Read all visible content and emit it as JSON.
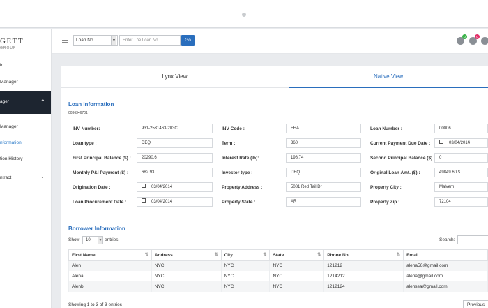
{
  "sidebar": {
    "logo": "GETT",
    "logo_sub": "GROUP",
    "items": [
      {
        "label": "in"
      },
      {
        "label": "Manager"
      },
      {
        "label": "ager"
      },
      {
        "label": "Manager"
      },
      {
        "label": "nformation"
      },
      {
        "label": "tion History"
      },
      {
        "label": "ntract"
      }
    ]
  },
  "header": {
    "select_value": "Loan No.",
    "input_placeholder": "Enter The Loan No.",
    "go_label": "Go",
    "badges": [
      "0",
      "0"
    ]
  },
  "tabs": [
    {
      "label": "Lynx View"
    },
    {
      "label": "Native View"
    }
  ],
  "loan_info": {
    "title": "Loan Information",
    "loan_id": "0036346701",
    "fields": [
      {
        "label": "INV Number:",
        "value": "931-2531463-203C"
      },
      {
        "label": "INV Code :",
        "value": "FHA"
      },
      {
        "label": "Loan Number :",
        "value": "00006"
      },
      {
        "label": "Loan type :",
        "value": "DEQ"
      },
      {
        "label": "Term :",
        "value": "360"
      },
      {
        "label": "Current Payment Due Date :",
        "value": "03/04/2014"
      },
      {
        "label": "First Principal Balance ($) :",
        "value": "20290.6"
      },
      {
        "label": "Interest Rate (%):",
        "value": "198.74"
      },
      {
        "label": "Second Principal Balance ($) :",
        "value": "0"
      },
      {
        "label": "Monthly P&I Payment ($) :",
        "value": "682.93"
      },
      {
        "label": "Investor type :",
        "value": "DEQ"
      },
      {
        "label": "Original Loan Amt. ($) :",
        "value": "49849.60 $"
      },
      {
        "label": "Origination Date :",
        "value": "03/04/2014"
      },
      {
        "label": "Property Address :",
        "value": "5081 Red Tail Dr"
      },
      {
        "label": "Property City :",
        "value": "Malvern"
      },
      {
        "label": "Loan Procurement Date :",
        "value": "03/04/2014"
      },
      {
        "label": "Property State :",
        "value": "AR"
      },
      {
        "label": "Property Zip :",
        "value": "72104"
      }
    ]
  },
  "borrower": {
    "title": "Borrower Information",
    "show_label": "Show",
    "entries_value": "10",
    "entries_label": "entries",
    "search_label": "Search:",
    "columns": [
      "First Name",
      "Address",
      "City",
      "State",
      "Phone No.",
      "Email"
    ],
    "rows": [
      [
        "Alen",
        "NYC",
        "NYC",
        "NYC",
        "121212",
        "alena56@gmail.com"
      ],
      [
        "Alena",
        "NYC",
        "NYC",
        "NYC",
        "1214212",
        "alena@gmail.com"
      ],
      [
        "Alenb",
        "NYC",
        "NYC",
        "NYC",
        "1212124",
        "alenssa@gmail.com"
      ]
    ],
    "showing": "Showing 1 to 3 of 3 entries",
    "previous_label": "Previous"
  },
  "colors": {
    "accent": "#2a6ebd",
    "sidebar_active": "#1d2530",
    "badge_green": "#3cb44b",
    "badge_pink": "#e2336b"
  }
}
